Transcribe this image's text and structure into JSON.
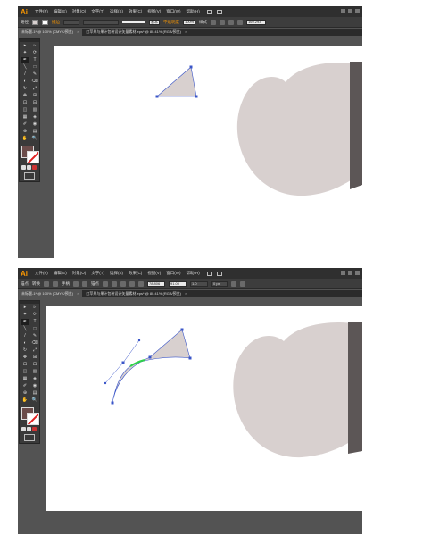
{
  "app": {
    "logo": "Ai"
  },
  "menu": [
    "文件(F)",
    "编辑(E)",
    "对象(O)",
    "文字(T)",
    "选择(S)",
    "效果(C)",
    "视图(V)",
    "窗口(W)",
    "帮助(H)"
  ],
  "control_bar_1": {
    "label": "路径",
    "stroke_label": "描边",
    "stroke_style": "基本",
    "opacity_label": "不透明度",
    "opacity_value": "100%",
    "style_label": "样式",
    "width_value": "169.293"
  },
  "control_bar_2": {
    "label": "锚点",
    "convert_label": "转换",
    "handles_label": "手柄",
    "anchor_label": "锚点",
    "x_value": "78.806",
    "y_value": "91.00",
    "w_value": "1.0",
    "h_value": "0 px"
  },
  "tabs_1": [
    {
      "label": "未标题-1* @ 100% (CMYK/预览)"
    },
    {
      "label": "红苹果与果汁包装设计矢量素材.eps* @ 80.41% (RGB/预览)"
    }
  ],
  "tabs_2": [
    {
      "label": "未标题-1* @ 100% (CMYK/预览)"
    },
    {
      "label": "红苹果与果汁包装设计矢量素材.eps* @ 80.41% (RGB/预览)"
    }
  ],
  "tools": [
    "▸",
    "▹",
    "✦",
    "⟳",
    "✒",
    "T",
    "╲",
    "□",
    "/",
    "✎",
    "◐",
    "⌫",
    "↻",
    "⤢",
    "✥",
    "⊞",
    "⊡",
    "⊟",
    "◫",
    "▥",
    "▦",
    "◈",
    "✐",
    "◉",
    "⊕",
    "▤",
    "✋",
    "🔍"
  ],
  "colors": {
    "panel_bg": "#535353",
    "menubar_bg": "#2f2f2f",
    "shape_fill": "#d8d0cf",
    "fill_swatch": "#6b4c4a",
    "anchor": "#3a55c8",
    "accent": "#ff9a00"
  }
}
